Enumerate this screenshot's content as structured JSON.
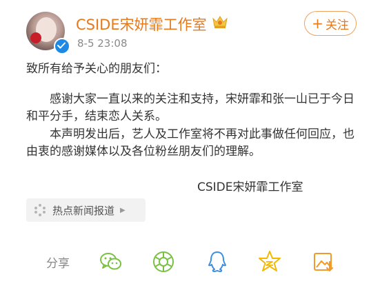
{
  "post": {
    "author": "CSIDE宋妍霏工作室",
    "time": "8-5 23:08",
    "follow_label": "关注"
  },
  "content": {
    "greeting": "致所有给予关心的朋友们：",
    "paragraph1": "感谢大家一直以来的关注和支持，宋妍霏和张一山已于今日和平分手，结束恋人关系。",
    "paragraph2": "本声明发出后，艺人及工作室将不再对此事做任何回应，也由衷的感谢媒体以及各位粉丝朋友们的理解。",
    "signature": "CSIDE宋妍霏工作室"
  },
  "topic": {
    "label": "热点新闻报道"
  },
  "share": {
    "label": "分享",
    "icons": [
      "wechat-icon",
      "moments-icon",
      "qq-icon",
      "qzone-icon",
      "save-image-icon"
    ]
  },
  "colors": {
    "accent": "#e8791b",
    "share_green": "#7ac143",
    "share_blue": "#3b8fe0",
    "share_yellow": "#f5b800",
    "share_orange": "#f09a2a",
    "verified_blue": "#1e88e5"
  }
}
